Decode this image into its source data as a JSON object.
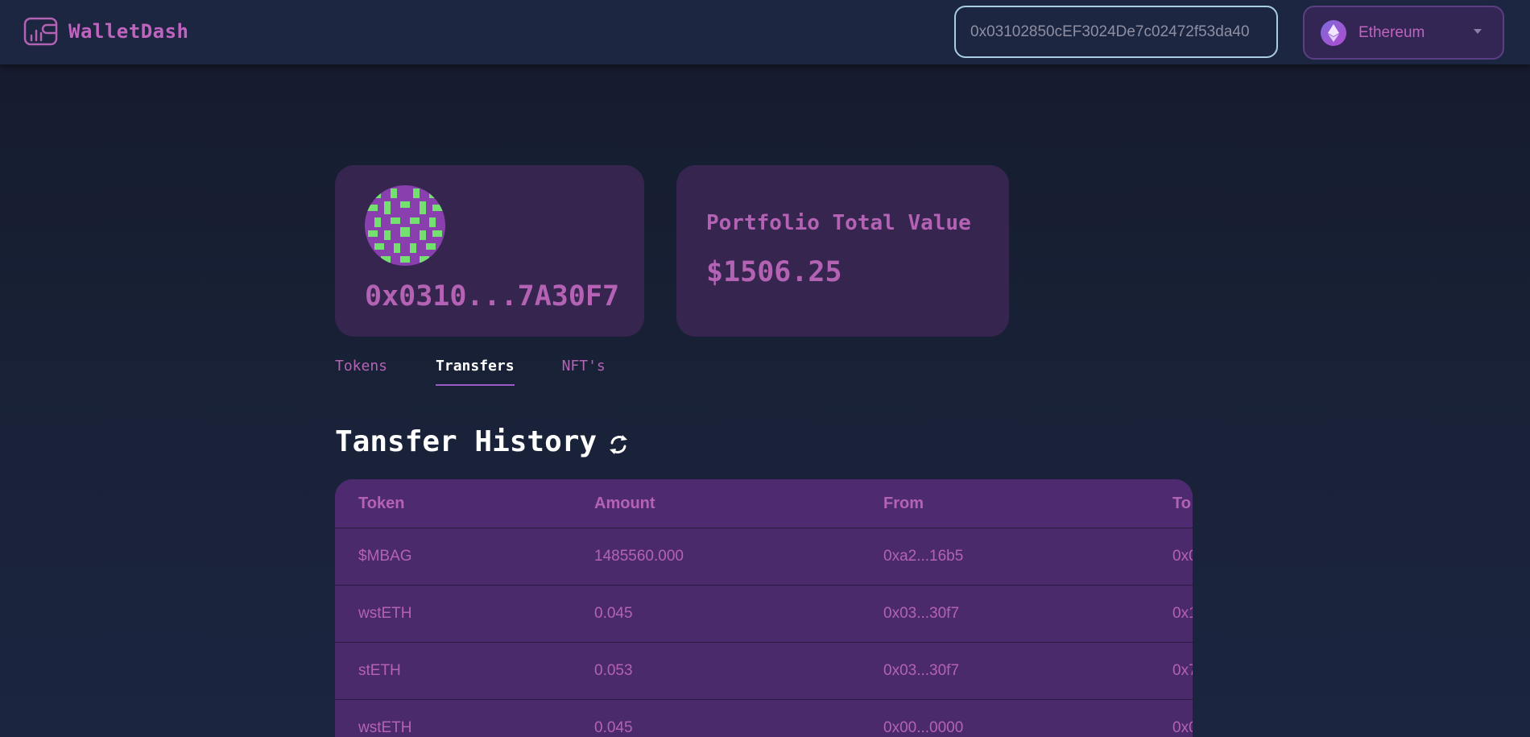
{
  "app": {
    "name": "WalletDash"
  },
  "header": {
    "address_value": "0x03102850cEF3024De7c02472f53da40",
    "network": "Ethereum"
  },
  "wallet": {
    "short_address": "0x0310...7A30F7"
  },
  "portfolio": {
    "title": "Portfolio Total Value",
    "value": "$1506.25"
  },
  "tabs": [
    {
      "label": "Tokens",
      "active": false
    },
    {
      "label": "Transfers",
      "active": true
    },
    {
      "label": "NFT's",
      "active": false
    }
  ],
  "transfers": {
    "title": "Tansfer History",
    "columns": [
      "Token",
      "Amount",
      "From",
      "To"
    ],
    "rows": [
      {
        "token": "$MBAG",
        "amount": "1485560.000",
        "from": "0xa2...16b5",
        "to": "0x0"
      },
      {
        "token": "wstETH",
        "amount": "0.045",
        "from": "0x03...30f7",
        "to": "0x1"
      },
      {
        "token": "stETH",
        "amount": "0.053",
        "from": "0x03...30f7",
        "to": "0x7"
      },
      {
        "token": "wstETH",
        "amount": "0.045",
        "from": "0x00...0000",
        "to": "0x0"
      }
    ]
  },
  "colors": {
    "accent": "#b462b4",
    "card": "#36264f",
    "table": "#4a2a6b",
    "background": "#192238"
  },
  "icons": {
    "logo": "wallet-chart-icon",
    "network": "ethereum-icon",
    "refresh": "refresh-icon",
    "dropdown": "chevron-down-icon"
  }
}
